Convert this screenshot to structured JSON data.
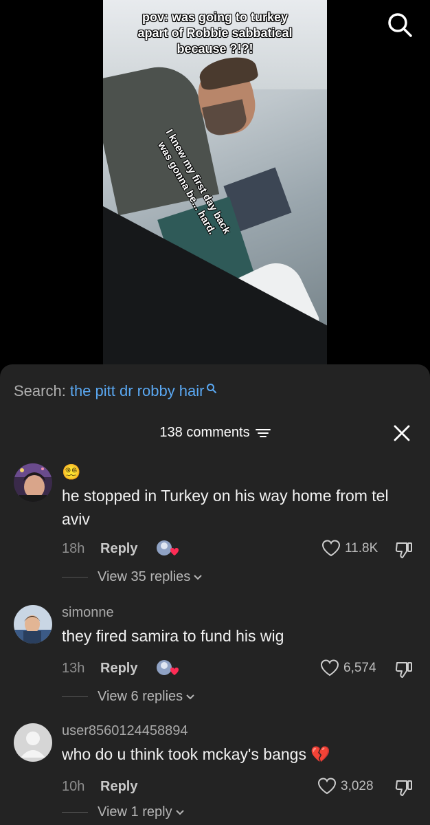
{
  "video": {
    "caption_top": "pov: was going to turkey apart of Robbie sabbatical because ?!?!",
    "caption_diagonal": "I knew my first day back was gonna be... hard."
  },
  "search": {
    "prefix": "Search:",
    "query": "the pitt dr robby hair"
  },
  "comments_header": {
    "count_label": "138 comments"
  },
  "comments": [
    {
      "username": "",
      "emoji": "😵‍💫",
      "text": "he stopped in Turkey on his way home from tel aviv",
      "time": "18h",
      "reply_label": "Reply",
      "likes": "11.8K",
      "view_replies": "View 35 replies",
      "creator_liked": true
    },
    {
      "username": "simonne",
      "text": "they fired samira to fund his wig",
      "time": "13h",
      "reply_label": "Reply",
      "likes": "6,574",
      "view_replies": "View 6 replies",
      "creator_liked": true
    },
    {
      "username": "user8560124458894",
      "text": "who do u think took mckay's bangs 💔",
      "time": "10h",
      "reply_label": "Reply",
      "likes": "3,028",
      "view_replies": "View 1 reply",
      "creator_liked": false
    }
  ],
  "colors": {
    "sheet_bg": "#232323",
    "link_blue": "#5aa8f2",
    "heart_red": "#fe2c55"
  },
  "icons": [
    "search-icon",
    "filter-icon",
    "close-icon",
    "heart-outline-icon",
    "dislike-icon",
    "chevron-down-icon",
    "creator-heart-icon"
  ]
}
